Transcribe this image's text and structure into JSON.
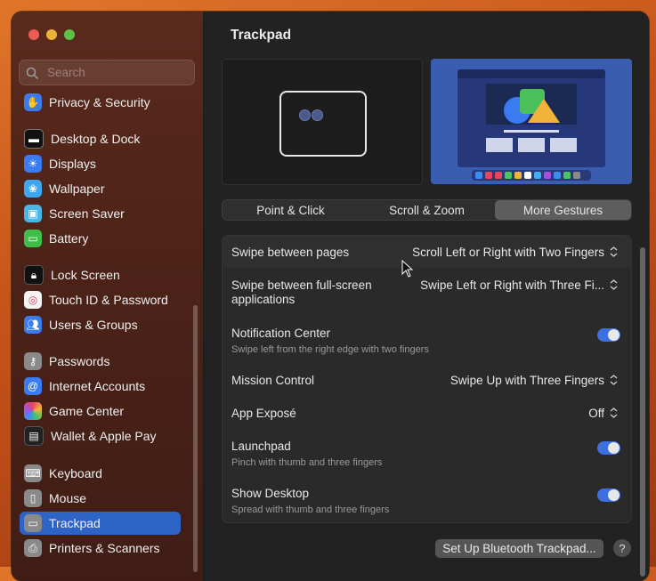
{
  "window": {
    "title": "Trackpad"
  },
  "search": {
    "placeholder": "Search"
  },
  "sidebar": {
    "items": [
      {
        "label": "Privacy & Security",
        "icon": "hand-icon",
        "color": "#3a7bf0"
      },
      {
        "label": "Desktop & Dock",
        "icon": "dock-icon",
        "color": "#111111"
      },
      {
        "label": "Displays",
        "icon": "sun-icon",
        "color": "#3a7bf0"
      },
      {
        "label": "Wallpaper",
        "icon": "flower-icon",
        "color": "#3fa6f0"
      },
      {
        "label": "Screen Saver",
        "icon": "screensaver-icon",
        "color": "#4ab6e8"
      },
      {
        "label": "Battery",
        "icon": "battery-icon",
        "color": "#3fbf4a"
      },
      {
        "label": "Lock Screen",
        "icon": "lock-icon",
        "color": "#111111"
      },
      {
        "label": "Touch ID & Password",
        "icon": "fingerprint-icon",
        "color": "#f4f4f4"
      },
      {
        "label": "Users & Groups",
        "icon": "users-icon",
        "color": "#3a7bf0"
      },
      {
        "label": "Passwords",
        "icon": "key-icon",
        "color": "#8a8a8a"
      },
      {
        "label": "Internet Accounts",
        "icon": "at-icon",
        "color": "#3a7bf0"
      },
      {
        "label": "Game Center",
        "icon": "gamecenter-icon",
        "color": "#e0e0e0"
      },
      {
        "label": "Wallet & Apple Pay",
        "icon": "wallet-icon",
        "color": "#222222"
      },
      {
        "label": "Keyboard",
        "icon": "keyboard-icon",
        "color": "#8a8a8a"
      },
      {
        "label": "Mouse",
        "icon": "mouse-icon",
        "color": "#8a8a8a"
      },
      {
        "label": "Trackpad",
        "icon": "trackpad-icon",
        "color": "#8a8a8a"
      },
      {
        "label": "Printers & Scanners",
        "icon": "printer-icon",
        "color": "#8a8a8a"
      }
    ],
    "selected": "Trackpad"
  },
  "tabs": [
    "Point & Click",
    "Scroll & Zoom",
    "More Gestures"
  ],
  "active_tab": "More Gestures",
  "gestures": {
    "swipe_pages": {
      "label": "Swipe between pages",
      "value": "Scroll Left or Right with Two Fingers"
    },
    "swipe_fullscreen": {
      "label": "Swipe between full-screen applications",
      "value": "Swipe Left or Right with Three Fi..."
    },
    "notification_center": {
      "label": "Notification Center",
      "sub": "Swipe left from the right edge with two fingers",
      "enabled": true
    },
    "mission_control": {
      "label": "Mission Control",
      "value": "Swipe Up with Three Fingers"
    },
    "app_expose": {
      "label": "App Exposé",
      "value": "Off"
    },
    "launchpad": {
      "label": "Launchpad",
      "sub": "Pinch with thumb and three fingers",
      "enabled": true
    },
    "show_desktop": {
      "label": "Show Desktop",
      "sub": "Spread with thumb and three fingers",
      "enabled": true
    }
  },
  "buttons": {
    "bluetooth": "Set Up Bluetooth Trackpad...",
    "help": "?"
  },
  "colors": {
    "accent": "#3d6fe0",
    "selected": "#2f64c7"
  }
}
